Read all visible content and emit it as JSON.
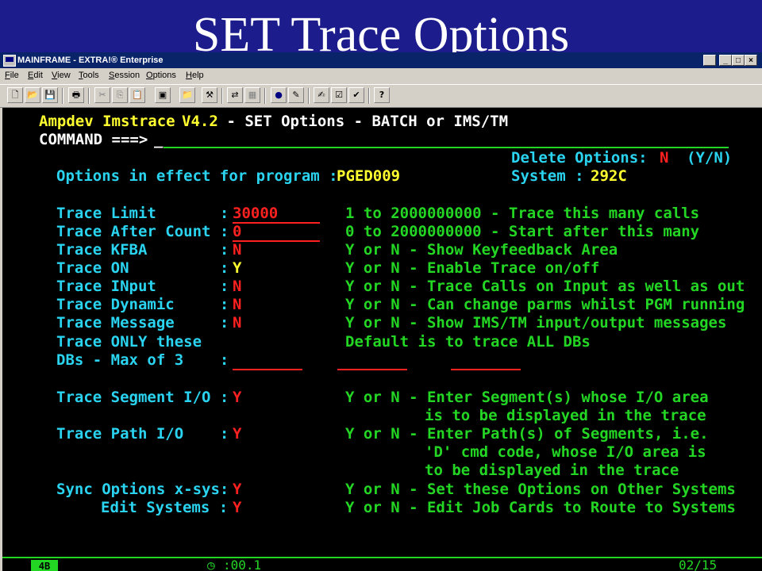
{
  "slide": {
    "title": "SET Trace Options"
  },
  "window": {
    "title": "MAINFRAME - EXTRA!® Enterprise",
    "controls": {
      "minimize": "_",
      "restore": "□",
      "close": "×"
    }
  },
  "menu": [
    "File",
    "Edit",
    "View",
    "Tools",
    "Session",
    "Options",
    "Help"
  ],
  "toolbar": {
    "icons": [
      "new-icon",
      "open-icon",
      "save-icon",
      "print-icon",
      "cut-icon",
      "copy-icon",
      "paste-icon",
      "terminal-icon",
      "folder-icon",
      "tools-icon",
      "transfer-icon",
      "macro-icon",
      "record-icon",
      "play-icon",
      "edit-icon",
      "form-icon",
      "check-icon",
      "help-icon"
    ],
    "glyphs": [
      "🗋",
      "📂",
      "💾",
      "🖶",
      "✂",
      "⎘",
      "📋",
      "▣",
      "📁",
      "⚒",
      "⇄",
      "▦",
      "●",
      "✎",
      "✍",
      "☑",
      "✔",
      "?"
    ]
  },
  "terminal": {
    "header_app": "Ampdev Imstrace ",
    "header_version": "V4.2",
    "header_rest": " - SET Options - BATCH or IMS/TM",
    "command_label": "COMMAND ===> ",
    "command_value": "_",
    "delete_label": "Delete Options:",
    "delete_value": "N",
    "delete_hint": "(Y/N)",
    "options_label": "Options in effect for program : ",
    "program": "PGED009",
    "system_label": "System : ",
    "system_value": "292C",
    "rows": [
      {
        "label": "Trace Limit       : ",
        "value": "30000",
        "desc": "1 to 2000000000 - Trace this many calls"
      },
      {
        "label": "Trace After Count : ",
        "value": "0",
        "desc": "0 to 2000000000 - Start after this many"
      },
      {
        "label": "Trace KFBA        : ",
        "value": "N",
        "desc": "Y or N - Show Keyfeedback Area"
      },
      {
        "label": "Trace ON          : ",
        "value": "Y",
        "desc": "Y or N - Enable Trace on/off"
      },
      {
        "label": "Trace INput       : ",
        "value": "N",
        "desc": "Y or N - Trace Calls on Input as well as out"
      },
      {
        "label": "Trace Dynamic     : ",
        "value": "N",
        "desc": "Y or N - Can change parms whilst PGM running"
      },
      {
        "label": "Trace Message     : ",
        "value": "N",
        "desc": "Y or N - Show IMS/TM input/output messages"
      }
    ],
    "only_label": "Trace ONLY these",
    "only_desc": "Default is to trace ALL DBs",
    "dbs_label": "DBs - Max of 3    : ",
    "seg_label": "Trace Segment I/O : ",
    "seg_value": "Y",
    "seg_desc1": "Y or N - Enter Segment(s) whose I/O area",
    "seg_desc2": "is to be displayed in the trace",
    "path_label": "Trace Path I/O    : ",
    "path_value": "Y",
    "path_desc1": "Y or N - Enter Path(s) of Segments, i.e.",
    "path_desc2": "'D' cmd code, whose I/O area is",
    "path_desc3": "to be displayed in the trace",
    "sync_label": "Sync Options x-sys: ",
    "sync_value": "Y",
    "sync_desc": "Y or N - Set these Options on Other Systems",
    "edit_label": "Edit Systems : ",
    "edit_value": "Y",
    "edit_desc": "Y or N - Edit Job Cards to Route to Systems"
  },
  "statusbar": {
    "box": "4B",
    "timer": ":00.1",
    "cursor": "02/15"
  }
}
